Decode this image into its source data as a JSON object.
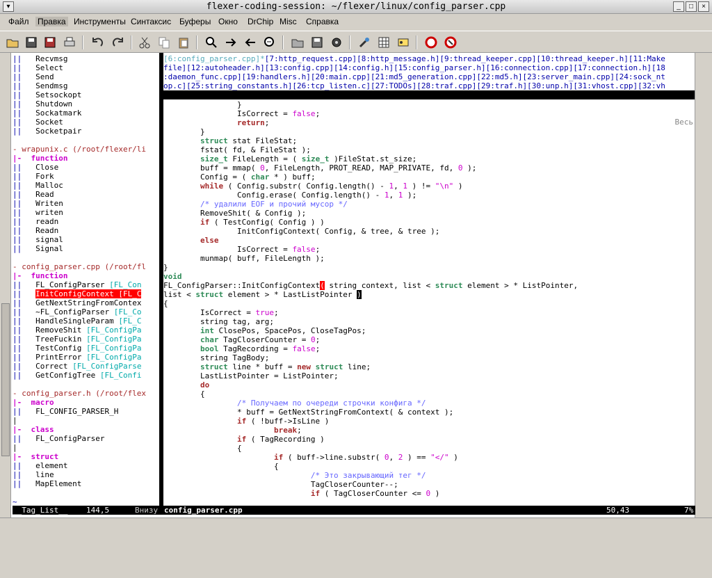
{
  "window": {
    "title": "flexer-coding-session: ~/flexer/linux/config_parser.cpp"
  },
  "menu": [
    {
      "label": "Файл"
    },
    {
      "label": "Правка"
    },
    {
      "label": "Инструменты"
    },
    {
      "label": "Синтаксис"
    },
    {
      "label": "Буферы"
    },
    {
      "label": "Окно"
    },
    {
      "label": "DrChip"
    },
    {
      "label": "Misc"
    },
    {
      "label": "Справка"
    }
  ],
  "toolbar": {
    "icons": [
      "open-icon",
      "save-icon",
      "save-all-icon",
      "print-icon",
      "undo-icon",
      "redo-icon",
      "cut-icon",
      "copy-icon",
      "paste-icon",
      "find-icon",
      "find-next-icon",
      "find-prev-icon",
      "replace-icon",
      "load-session-icon",
      "save-session-icon",
      "run-script-icon",
      "make-icon",
      "build-tags-icon",
      "jump-tag-icon",
      "help-icon",
      "help-search-icon"
    ]
  },
  "taglist": {
    "lines": [
      "||   Recvmsg",
      "||   Select",
      "||   Send",
      "||   Sendmsg",
      "||   Setsockopt",
      "||   Shutdown",
      "||   Sockatmark",
      "||   Socket",
      "||   Socketpair",
      "",
      "- wrapunix.c (/root/flexer/li",
      "|-  function",
      "||   Close",
      "||   Fork",
      "||   Malloc",
      "||   Read",
      "||   Writen",
      "||   writen",
      "||   readn",
      "||   Readn",
      "||   signal",
      "||   Signal",
      "",
      "- config_parser.cpp (/root/fl",
      "|-  function",
      "||   FL_ConfigParser [FL_Con",
      "||   InitConfigContext [FL_C",
      "||   GetNextStringFromContex",
      "||   ~FL_ConfigParser [FL_Co",
      "||   HandleSingleParam [FL_C",
      "||   RemoveShit [FL_ConfigPa",
      "||   TreeFuckin [FL_ConfigPa",
      "||   TestConfig [FL_ConfigPa",
      "||   PrintError [FL_ConfigPa",
      "||   Correct [FL_ConfigParse",
      "||   GetConfigTree [FL_Confi",
      "",
      "- config_parser.h (/root/flex",
      "|-  macro",
      "||   FL_CONFIG_PARSER_H",
      "|",
      "|-  class",
      "||   FL_ConfigParser",
      "|",
      "|-  struct",
      "||   element",
      "||   line",
      "||   MapElement",
      "",
      "~"
    ]
  },
  "minibuf": {
    "lines": [
      "[6:config_parser.cpp]*[7:http_request.cpp][8:http_message.h][9:thread_keeper.cpp][10:thread_keeper.h][11:Make",
      "file][12:autoheader.h][13:config.cpp][14:config.h][15:config_parser.h][16:connection.cpp][17:connection.h][18",
      ":daemon_func.cpp][19:handlers.h][20:main.cpp][21:md5_generation.cpp][22:md5.h][23:server_main.cpp][24:sock_nt",
      "op.c][25:string_constants.h][26:tcp_listen.c][27:TODOs][28:traf.cpp][29:traf.h][30:unp.h][31:vhost.cpp][32:vh"
    ],
    "status_name": "-MiniBufExplorer-",
    "status_pos": "1,1",
    "status_scroll": "Becь"
  },
  "source": {
    "lines": [
      "                }",
      "                IsCorrect = false;",
      "                return;",
      "        }",
      "        struct stat FileStat;",
      "        fstat( fd, & FileStat );",
      "        size_t FileLength = ( size_t )FileStat.st_size;",
      "        buff = mmap( 0, FileLength, PROT_READ, MAP_PRIVATE, fd, 0 );",
      "        Config = ( char * ) buff;",
      "        while ( Config.substr( Config.length() - 1, 1 ) != \"\\n\" )",
      "                Config.erase( Config.length() - 1, 1 );",
      "        /* удалили EOF и прочий мусор */",
      "        RemoveShit( & Config );",
      "        if ( TestConfig( Config ) )",
      "                InitConfigContext( Config, & tree, & tree );",
      "        else",
      "                IsCorrect = false;",
      "        munmap( buff, FileLength );",
      "}",
      "void",
      "FL_ConfigParser::InitConfigContext( string context, list < struct element > * ListPointer,",
      "list < struct element > * LastListPointer )",
      "{",
      "        IsCorrect = true;",
      "        string tag, arg;",
      "        int ClosePos, SpacePos, CloseTagPos;",
      "        char TagCloserCounter = 0;",
      "        bool TagRecording = false;",
      "        string TagBody;",
      "        struct line * buff = new struct line;",
      "        LastListPointer = ListPointer;",
      "        do",
      "        {",
      "                /* Получаем по очереди строчки конфига */",
      "                * buff = GetNextStringFromContext( & context );",
      "                if ( !buff->IsLine )",
      "                        break;",
      "                if ( TagRecording )",
      "                {",
      "                        if ( buff->line.substr( 0, 2 ) == \"</\" )",
      "                        {",
      "                                /* Это закрывающий тег */",
      "                                TagCloserCounter--;",
      "                                if ( TagCloserCounter <= 0 )"
    ]
  },
  "statusline": {
    "left_name": "__Tag_List__",
    "left_pos": "144,5",
    "left_where": "Внизу",
    "right_name": "config_parser.cpp",
    "right_pos": "50,43",
    "right_pct": "7%"
  }
}
